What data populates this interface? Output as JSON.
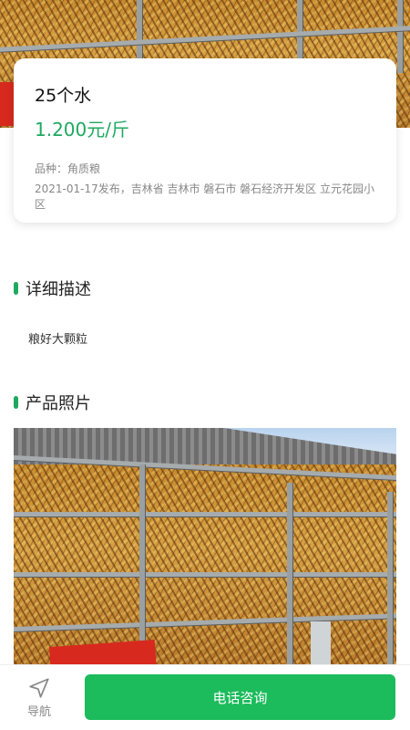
{
  "product": {
    "title": "25个水",
    "price": "1.200元/斤",
    "variety": "品种：角质粮",
    "meta": "2021-01-17发布，吉林省 吉林市 磐石市 磐石经济开发区 立元花园小区"
  },
  "description": {
    "heading": "详细描述",
    "text": "粮好大颗粒"
  },
  "photos": {
    "heading": "产品照片"
  },
  "bottom_bar": {
    "nav_label": "导航",
    "call_label": "电话咨询"
  },
  "colors": {
    "accent": "#1ea960",
    "button": "#1cbb5c"
  },
  "icons": {
    "nav": "navigation-arrow-icon"
  }
}
